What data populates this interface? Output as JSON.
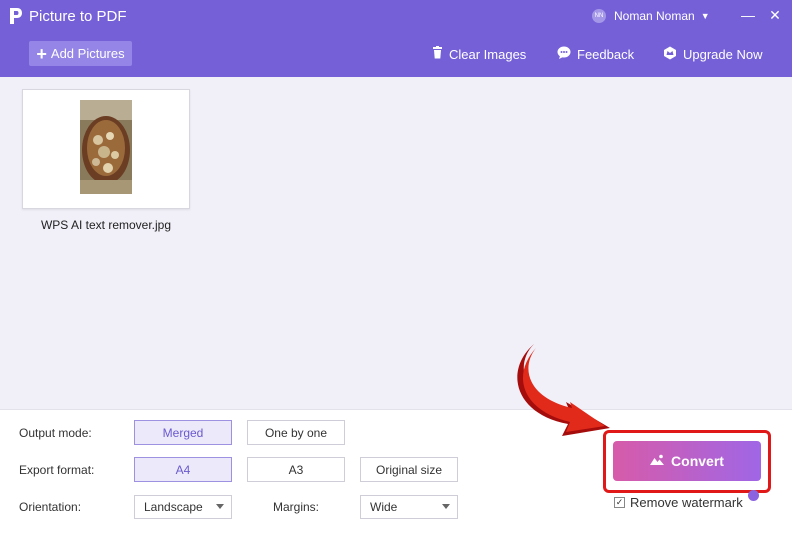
{
  "app": {
    "title": "Picture to PDF"
  },
  "user": {
    "name": "Noman Noman",
    "avatar_text": "NN"
  },
  "window_controls": {
    "minimize": "—",
    "close": "✕"
  },
  "toolbar": {
    "add_label": "Add Pictures",
    "clear_label": "Clear Images",
    "feedback_label": "Feedback",
    "upgrade_label": "Upgrade Now"
  },
  "files": [
    {
      "name": "WPS AI text remover.jpg"
    }
  ],
  "options": {
    "output_mode": {
      "label": "Output mode:",
      "choices": [
        "Merged",
        "One by one"
      ],
      "selected": "Merged"
    },
    "export_format": {
      "label": "Export format:",
      "choices": [
        "A4",
        "A3",
        "Original size"
      ],
      "selected": "A4"
    },
    "orientation": {
      "label": "Orientation:",
      "value": "Landscape"
    },
    "margins": {
      "label": "Margins:",
      "value": "Wide"
    }
  },
  "convert": {
    "label": "Convert"
  },
  "watermark": {
    "label": "Remove watermark",
    "checked": true,
    "check_glyph": "✓"
  },
  "colors": {
    "header": "#7560d8",
    "accent": "#6a5acd",
    "highlight": "#e01818"
  },
  "icons": [
    "logo-icon",
    "user-caret-icon",
    "plus-icon",
    "trash-icon",
    "feedback-icon",
    "upgrade-icon",
    "convert-icon",
    "premium-icon",
    "caret-down-icon",
    "arrow-icon"
  ]
}
